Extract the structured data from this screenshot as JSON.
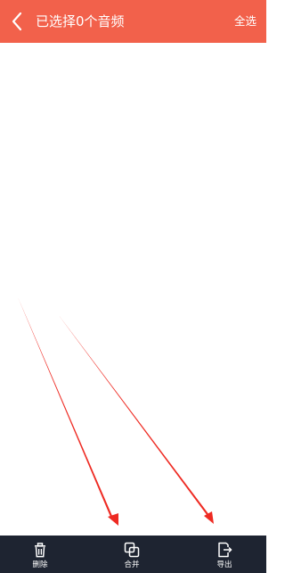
{
  "colors": {
    "header_bg": "#f2614b",
    "bottom_bar_bg": "#1e2431",
    "annotation_arrow": "#ee2a22"
  },
  "header": {
    "back_icon": "chevron-left-icon",
    "title": "已选择0个音频",
    "select_all_label": "全选"
  },
  "bottom_bar": {
    "actions": [
      {
        "label": "删除",
        "icon": "trash-icon"
      },
      {
        "label": "合并",
        "icon": "merge-icon"
      },
      {
        "label": "导出",
        "icon": "export-icon"
      }
    ]
  }
}
